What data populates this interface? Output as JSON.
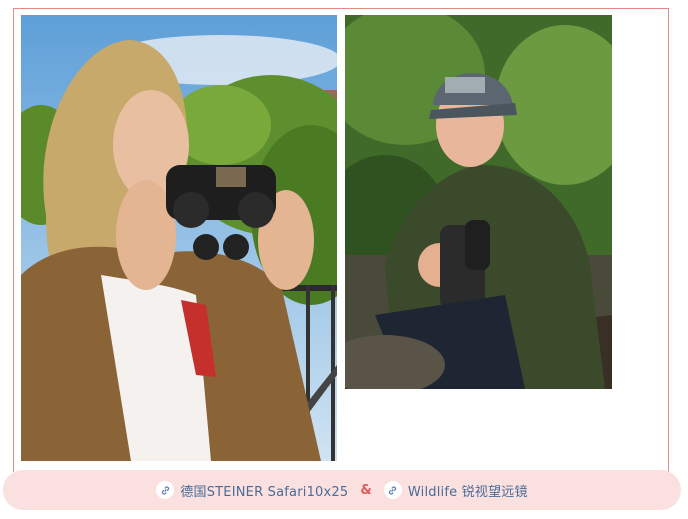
{
  "links": [
    {
      "label": "德国STEINER Safari10x25",
      "icon": "link-icon"
    },
    {
      "label": "Wildlife 锐视望远镜",
      "icon": "link-icon"
    }
  ],
  "separator": "&",
  "images": [
    {
      "name": "woman-with-binoculars-photo",
      "alt": "Woman looking through compact binoculars"
    },
    {
      "name": "man-with-binoculars-photo",
      "alt": "Man in cap holding binoculars in forest"
    }
  ],
  "colors": {
    "bar_bg": "#fbe0e0",
    "link_text": "#4a6b98",
    "separator": "#e05a5a",
    "frame": "#e58a8a"
  }
}
